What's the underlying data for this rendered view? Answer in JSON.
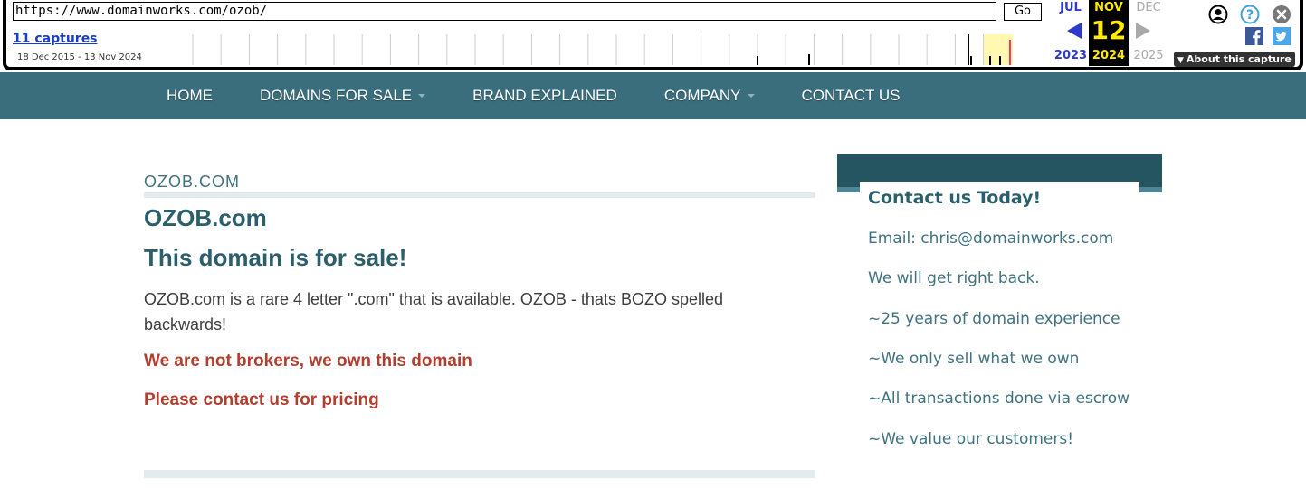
{
  "wayback": {
    "url": "https://www.domainworks.com/ozob/",
    "go_label": "Go",
    "captures_label": "11 captures",
    "date_range": "18 Dec 2015 - 13 Nov 2024",
    "prev_month": "JUL",
    "prev_year": "2023",
    "current_month": "NOV",
    "current_day": "12",
    "current_year": "2024",
    "next_month": "DEC",
    "next_year": "2025",
    "about_label": "About this capture",
    "icons": [
      "account-icon",
      "help-icon",
      "close-icon",
      "facebook-icon",
      "twitter-icon"
    ]
  },
  "nav": {
    "items": [
      {
        "label": "HOME",
        "dropdown": false
      },
      {
        "label": "DOMAINS FOR SALE",
        "dropdown": true
      },
      {
        "label": "BRAND EXPLAINED",
        "dropdown": false
      },
      {
        "label": "COMPANY",
        "dropdown": true
      },
      {
        "label": "CONTACT US",
        "dropdown": false
      }
    ]
  },
  "main": {
    "breadcrumb": "OZOB.COM",
    "title": "OZOB.com",
    "subtitle": "This domain is for sale!",
    "description": "OZOB.com is a rare 4 letter \".com\" that is available. OZOB - thats BOZO spelled backwards!",
    "note1": "We are not brokers, we own this domain",
    "note2": "Please contact us for pricing"
  },
  "sidebar": {
    "title": "Contact us Today!",
    "lines": [
      "Email: chris@domainworks.com",
      "We will get right back.",
      "~25 years of domain experience",
      "~We only sell what we own",
      "~All transactions done via escrow",
      "~We value our customers!"
    ]
  },
  "colors": {
    "nav_bg": "#3a6e7c",
    "heading": "#2a5f6b",
    "accent_red": "#b13e2e",
    "sidebar_header": "#245560"
  }
}
